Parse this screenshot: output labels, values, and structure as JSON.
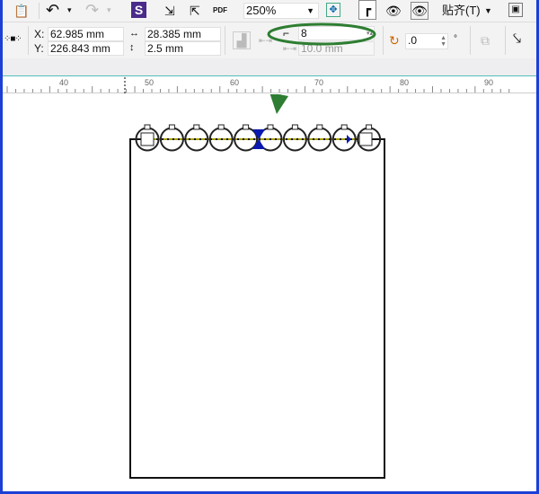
{
  "toolbar": {
    "zoom_value": "250%",
    "snap_label": "贴齐(T)"
  },
  "icons": [
    "paste-icon",
    "undo-icon",
    "redo-icon",
    "app-launcher-icon",
    "import-icon",
    "export-icon",
    "pdf-icon",
    "zoom-fit-icon",
    "page-frame-icon",
    "view-grid-icon",
    "view-guides-icon",
    "options-icon"
  ],
  "properties": {
    "x_label": "X:",
    "x_value": "62.985 mm",
    "y_label": "Y:",
    "y_value": "226.843 mm",
    "width_value": "28.385 mm",
    "height_value": "2.5 mm",
    "step_count": "8",
    "step_spacing": "10.0 mm",
    "rotation": ".0",
    "rotation_unit": "°"
  },
  "ruler": {
    "ticks": [
      "40",
      "50",
      "60",
      "70",
      "80",
      "90"
    ]
  },
  "annotation_color": "#2e7d32",
  "drawing": {
    "circle_count": 10,
    "selection_color": "#0a1ab0"
  }
}
